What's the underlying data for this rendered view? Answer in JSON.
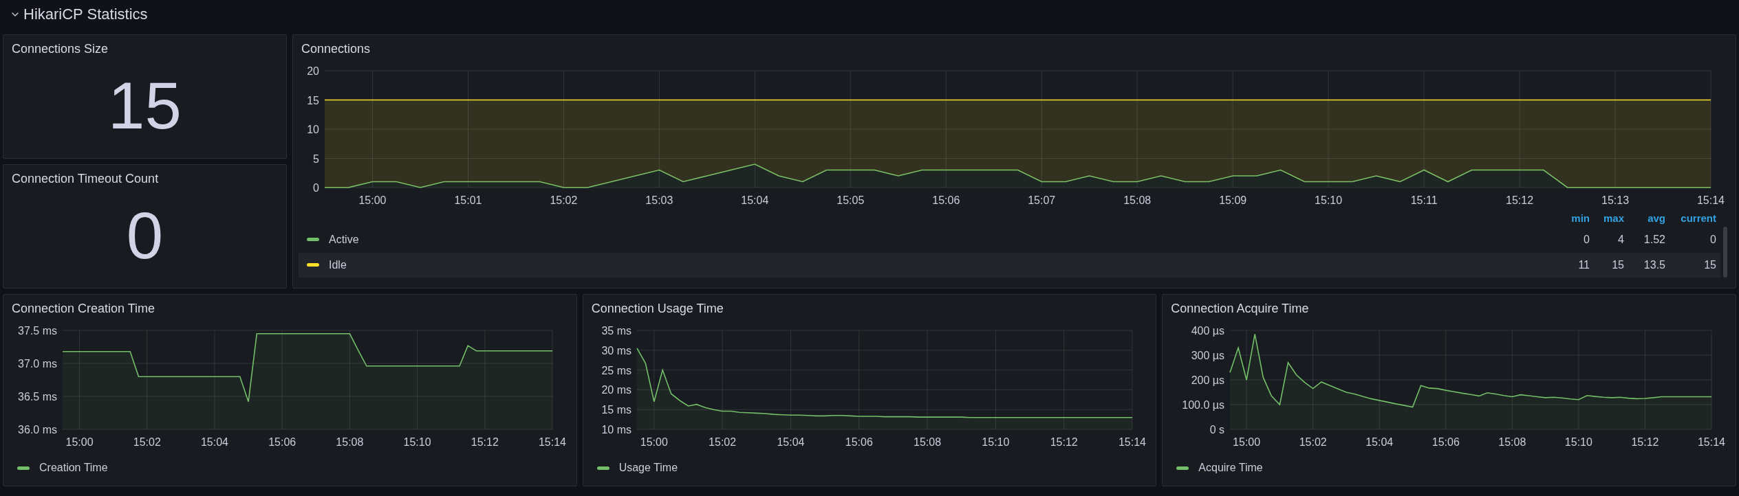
{
  "header": {
    "title": "HikariCP Statistics"
  },
  "stat_panels": [
    {
      "title": "Connections Size",
      "value": "15"
    },
    {
      "title": "Connection Timeout Count",
      "value": "0"
    }
  ],
  "connections_panel": {
    "title": "Connections",
    "chart_data": {
      "type": "area",
      "stacked": true,
      "grid": true,
      "categories": [
        null,
        null,
        "15:00",
        null,
        null,
        null,
        "15:01",
        null,
        null,
        null,
        "15:02",
        null,
        null,
        null,
        "15:03",
        null,
        null,
        null,
        "15:04",
        null,
        null,
        null,
        "15:05",
        null,
        null,
        null,
        "15:06",
        null,
        null,
        null,
        "15:07",
        null,
        null,
        null,
        "15:08",
        null,
        null,
        null,
        "15:09",
        null,
        null,
        null,
        "15:10",
        null,
        null,
        null,
        "15:11",
        null,
        null,
        null,
        "15:12",
        null,
        null,
        null,
        "15:13",
        null,
        null,
        null,
        "15:14"
      ],
      "series": [
        {
          "name": "Active",
          "color": "#73bf69",
          "values": [
            0,
            0,
            1,
            1,
            0,
            1,
            1,
            1,
            1,
            1,
            0,
            0,
            1,
            2,
            3,
            1,
            2,
            3,
            4,
            2,
            1,
            3,
            3,
            3,
            2,
            3,
            3,
            3,
            3,
            3,
            1,
            1,
            2,
            1,
            1,
            2,
            1,
            1,
            2,
            2,
            3,
            1,
            1,
            1,
            2,
            1,
            3,
            1,
            3,
            3,
            3,
            3,
            0,
            0,
            0,
            0,
            0,
            0,
            0
          ]
        },
        {
          "name": "Idle",
          "color": "#fade2a",
          "values": [
            15,
            15,
            14,
            14,
            15,
            14,
            14,
            14,
            14,
            14,
            15,
            15,
            14,
            13,
            12,
            14,
            13,
            12,
            11,
            13,
            14,
            12,
            12,
            12,
            13,
            12,
            12,
            12,
            12,
            12,
            14,
            14,
            13,
            14,
            14,
            13,
            14,
            14,
            13,
            13,
            12,
            14,
            14,
            14,
            13,
            14,
            12,
            14,
            12,
            12,
            12,
            12,
            15,
            15,
            15,
            15,
            15,
            15,
            15
          ]
        }
      ],
      "ylim": [
        0,
        20
      ],
      "yticks": [
        0,
        5,
        10,
        15,
        20
      ]
    },
    "legend_columns": [
      "min",
      "max",
      "avg",
      "current"
    ],
    "legend_values": [
      [
        "0",
        "4",
        "1.52",
        "0"
      ],
      [
        "11",
        "15",
        "13.5",
        "15"
      ]
    ]
  },
  "bottom_panels": [
    {
      "title": "Connection Creation Time",
      "chart_data": {
        "type": "area",
        "grid": true,
        "categories": [
          null,
          null,
          "15:00",
          null,
          null,
          null,
          null,
          null,
          null,
          null,
          "15:02",
          null,
          null,
          null,
          null,
          null,
          null,
          null,
          "15:04",
          null,
          null,
          null,
          null,
          null,
          null,
          null,
          "15:06",
          null,
          null,
          null,
          null,
          null,
          null,
          null,
          "15:08",
          null,
          null,
          null,
          null,
          null,
          null,
          null,
          "15:10",
          null,
          null,
          null,
          null,
          null,
          null,
          null,
          "15:12",
          null,
          null,
          null,
          null,
          null,
          null,
          null,
          "15:14"
        ],
        "series": [
          {
            "name": "Creation Time",
            "color": "#73bf69",
            "values": [
              37.18,
              37.18,
              37.18,
              37.18,
              37.18,
              37.18,
              37.18,
              37.18,
              37.18,
              36.8,
              36.8,
              36.8,
              36.8,
              36.8,
              36.8,
              36.8,
              36.8,
              36.8,
              36.8,
              36.8,
              36.8,
              36.8,
              36.42,
              37.45,
              37.45,
              37.45,
              37.45,
              37.45,
              37.45,
              37.45,
              37.45,
              37.45,
              37.45,
              37.45,
              37.45,
              37.2,
              36.96,
              36.96,
              36.96,
              36.96,
              36.96,
              36.96,
              36.96,
              36.96,
              36.96,
              36.96,
              36.96,
              36.96,
              37.27,
              37.19,
              37.19,
              37.19,
              37.19,
              37.19,
              37.19,
              37.19,
              37.19,
              37.19,
              37.19
            ]
          }
        ],
        "ylim": [
          36,
          37.5
        ],
        "yticks": [
          {
            "value": 36,
            "label": "36.0 ms"
          },
          {
            "value": 36.5,
            "label": "36.5 ms"
          },
          {
            "value": 37,
            "label": "37.0 ms"
          },
          {
            "value": 37.5,
            "label": "37.5 ms"
          }
        ]
      }
    },
    {
      "title": "Connection Usage Time",
      "chart_data": {
        "type": "area",
        "grid": true,
        "categories": [
          null,
          null,
          "15:00",
          null,
          null,
          null,
          null,
          null,
          null,
          null,
          "15:02",
          null,
          null,
          null,
          null,
          null,
          null,
          null,
          "15:04",
          null,
          null,
          null,
          null,
          null,
          null,
          null,
          "15:06",
          null,
          null,
          null,
          null,
          null,
          null,
          null,
          "15:08",
          null,
          null,
          null,
          null,
          null,
          null,
          null,
          "15:10",
          null,
          null,
          null,
          null,
          null,
          null,
          null,
          "15:12",
          null,
          null,
          null,
          null,
          null,
          null,
          null,
          "15:14"
        ],
        "series": [
          {
            "name": "Usage Time",
            "color": "#73bf69",
            "values": [
              30.5,
              26.7,
              17,
              25,
              19,
              17.3,
              15.9,
              16.3,
              15.5,
              15,
              14.6,
              14.6,
              14.3,
              14.2,
              14.1,
              14,
              13.8,
              13.7,
              13.6,
              13.6,
              13.5,
              13.4,
              13.4,
              13.5,
              13.5,
              13.4,
              13.3,
              13.3,
              13.3,
              13.2,
              13.2,
              13.2,
              13.2,
              13.1,
              13.1,
              13.1,
              13.1,
              13.1,
              13.1,
              13,
              13,
              13,
              13,
              13,
              13,
              13,
              13,
              13,
              13,
              13,
              13,
              13,
              13,
              13,
              13,
              13,
              13,
              13,
              13
            ]
          }
        ],
        "ylim": [
          10,
          35
        ],
        "yticks": [
          {
            "value": 10,
            "label": "10 ms"
          },
          {
            "value": 15,
            "label": "15 ms"
          },
          {
            "value": 20,
            "label": "20 ms"
          },
          {
            "value": 25,
            "label": "25 ms"
          },
          {
            "value": 30,
            "label": "30 ms"
          },
          {
            "value": 35,
            "label": "35 ms"
          }
        ]
      }
    },
    {
      "title": "Connection Acquire Time",
      "chart_data": {
        "type": "area",
        "grid": true,
        "categories": [
          null,
          null,
          "15:00",
          null,
          null,
          null,
          null,
          null,
          null,
          null,
          "15:02",
          null,
          null,
          null,
          null,
          null,
          null,
          null,
          "15:04",
          null,
          null,
          null,
          null,
          null,
          null,
          null,
          "15:06",
          null,
          null,
          null,
          null,
          null,
          null,
          null,
          "15:08",
          null,
          null,
          null,
          null,
          null,
          null,
          null,
          "15:10",
          null,
          null,
          null,
          null,
          null,
          null,
          null,
          "15:12",
          null,
          null,
          null,
          null,
          null,
          null,
          null,
          "15:14"
        ],
        "series": [
          {
            "name": "Acquire Time",
            "color": "#73bf69",
            "values": [
              230,
              330,
              200,
              385,
              210,
              135,
              100,
              270,
              220,
              190,
              165,
              192,
              178,
              164,
              150,
              143,
              133,
              124,
              117,
              110,
              103,
              97,
              90,
              177,
              167,
              165,
              158,
              152,
              146,
              141,
              135,
              148,
              143,
              137,
              132,
              140,
              136,
              132,
              128,
              130,
              127,
              123,
              120,
              137,
              133,
              130,
              128,
              130,
              126,
              124,
              125,
              128,
              132,
              132,
              132,
              132,
              132,
              132,
              132
            ]
          }
        ],
        "ylim": [
          0,
          400
        ],
        "yticks": [
          {
            "value": 0,
            "label": "0 s"
          },
          {
            "value": 100,
            "label": "100.0 µs"
          },
          {
            "value": 200,
            "label": "200 µs"
          },
          {
            "value": 300,
            "label": "300 µs"
          },
          {
            "value": 400,
            "label": "400 µs"
          }
        ]
      }
    }
  ]
}
